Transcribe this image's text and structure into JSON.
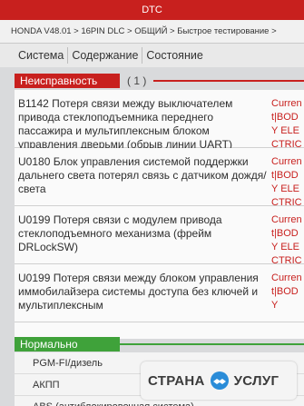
{
  "title": "DTC",
  "breadcrumb": "HONDA V48.01 > 16PIN DLC > ОБЩИЙ > Быстрое тестирование >",
  "tabs": [
    {
      "label": "Система"
    },
    {
      "label": "Содержание"
    },
    {
      "label": "Состояние"
    }
  ],
  "faults": {
    "header": "Неисправность",
    "count": "( 1 )",
    "items": [
      {
        "description": "B1142 Потеря связи между выключателем привода стеклоподъемника переднего пассажира и мультиплексным блоком управления дверьми (обрыв линии UART)",
        "status": "Current|BODY ELECTRICAL"
      },
      {
        "description": "U0180 Блок управления системой поддержки дальнего света потерял связь с датчиком дождя/света",
        "status": "Current|BODY ELECTRICAL"
      },
      {
        "description": "U0199 Потеря связи с модулем привода стеклоподъемного механизма (фрейм DRLockSW)",
        "status": "Current|BODY ELECTRICAL"
      },
      {
        "description": "U0199 Потеря связи между блоком управления иммобилайзера системы доступа без ключей и мультиплексным",
        "status": "Current|BODY"
      }
    ]
  },
  "normal": {
    "header": "Нормально",
    "items": [
      {
        "label": "PGM-FI/дизель"
      },
      {
        "label": "АКПП"
      },
      {
        "label": "ABS (антиблокировочная система)"
      }
    ]
  },
  "watermark": {
    "left": "СТРАНА",
    "right": "УСЛУГ"
  },
  "colors": {
    "accent_red": "#c8201e",
    "normal_green": "#3fa23a"
  }
}
